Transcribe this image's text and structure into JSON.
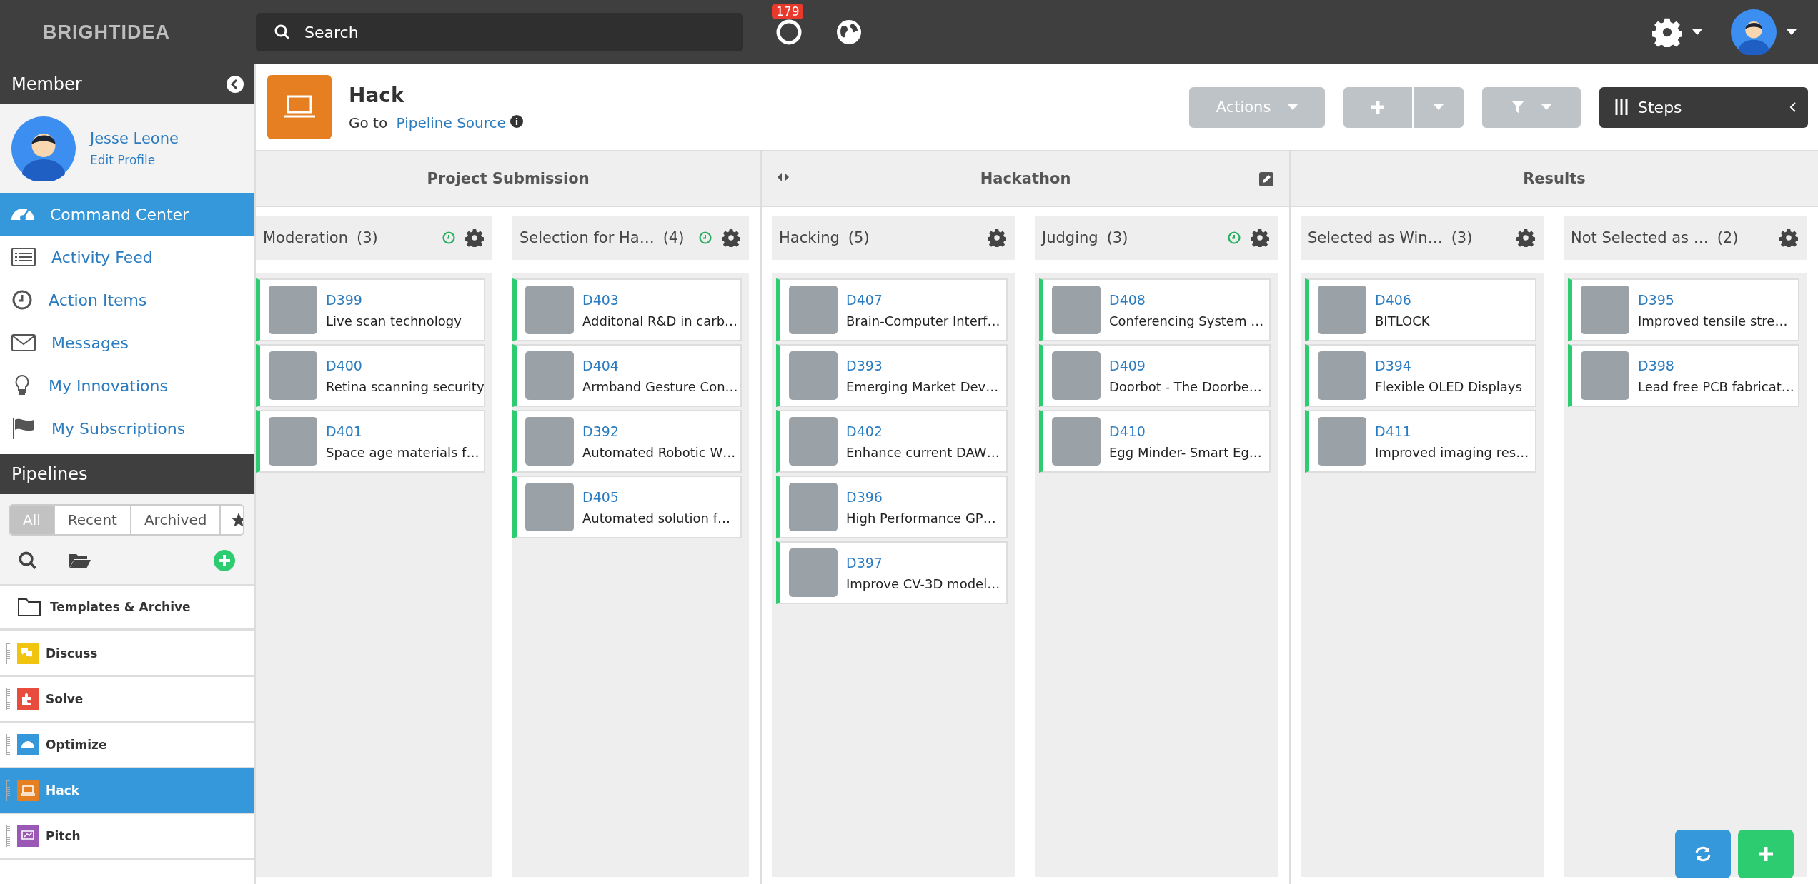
{
  "topbar": {
    "logo": "BRIGHTIDEA",
    "search_placeholder": "Search",
    "notification_count": "179"
  },
  "sidebar": {
    "member_title": "Member",
    "user_name": "Jesse Leone",
    "edit_profile": "Edit Profile",
    "nav": [
      {
        "label": "Command Center",
        "kind": "dashboard",
        "selected": true
      },
      {
        "label": "Activity Feed",
        "kind": "feed",
        "selected": false
      },
      {
        "label": "Action Items",
        "kind": "tasks",
        "selected": false
      },
      {
        "label": "Messages",
        "kind": "messages",
        "selected": false
      },
      {
        "label": "My Innovations",
        "kind": "innovations",
        "selected": false
      },
      {
        "label": "My Subscriptions",
        "kind": "subscriptions",
        "selected": false
      }
    ],
    "pipelines_title": "Pipelines",
    "filter_tabs": [
      {
        "label": "All",
        "selected": true
      },
      {
        "label": "Recent",
        "selected": false
      },
      {
        "label": "Archived",
        "selected": false
      }
    ],
    "templates": "Templates & Archive",
    "pipelines": [
      {
        "label": "Discuss",
        "color": "#f1c40f",
        "kind": "discuss",
        "selected": false
      },
      {
        "label": "Solve",
        "color": "#e74c3c",
        "kind": "solve",
        "selected": false
      },
      {
        "label": "Optimize",
        "color": "#3498db",
        "kind": "optimize",
        "selected": false
      },
      {
        "label": "Hack",
        "color": "#e67e22",
        "kind": "hack",
        "selected": true
      },
      {
        "label": "Pitch",
        "color": "#9b59b6",
        "kind": "pitch",
        "selected": false
      }
    ]
  },
  "header": {
    "title": "Hack",
    "goto_prefix": "Go to",
    "goto_link": "Pipeline Source",
    "actions": "Actions",
    "steps": "Steps"
  },
  "stages": [
    {
      "title": "Project Submission",
      "arrows": false,
      "edit": false,
      "lanes": [
        {
          "title": "Moderation",
          "count": "(3)",
          "timer": true,
          "cards": [
            {
              "id": "D399",
              "text": "Live scan technology"
            },
            {
              "id": "D400",
              "text": "Retina scanning security"
            },
            {
              "id": "D401",
              "text": "Space age materials f…"
            }
          ]
        },
        {
          "title": "Selection for Ha…",
          "count": "(4)",
          "timer": true,
          "cards": [
            {
              "id": "D403",
              "text": "Additonal R&D in carb…"
            },
            {
              "id": "D404",
              "text": "Armband Gesture Con…"
            },
            {
              "id": "D392",
              "text": "Automated Robotic W…"
            },
            {
              "id": "D405",
              "text": "Automated solution f…"
            }
          ]
        }
      ]
    },
    {
      "title": "Hackathon",
      "arrows": true,
      "edit": true,
      "lanes": [
        {
          "title": "Hacking",
          "count": "(5)",
          "timer": false,
          "cards": [
            {
              "id": "D407",
              "text": "Brain-Computer Interf…"
            },
            {
              "id": "D393",
              "text": "Emerging Market Dev…"
            },
            {
              "id": "D402",
              "text": "Enhance current DAW…"
            },
            {
              "id": "D396",
              "text": "High Performance GP…"
            },
            {
              "id": "D397",
              "text": "Improve CV-3D model…"
            }
          ]
        },
        {
          "title": "Judging",
          "count": "(3)",
          "timer": true,
          "cards": [
            {
              "id": "D408",
              "text": "Conferencing System …"
            },
            {
              "id": "D409",
              "text": "Doorbot - The Doorbe…"
            },
            {
              "id": "D410",
              "text": "Egg Minder- Smart Eg…"
            }
          ]
        }
      ]
    },
    {
      "title": "Results",
      "arrows": false,
      "edit": false,
      "lanes": [
        {
          "title": "Selected as Win…",
          "count": "(3)",
          "timer": false,
          "cards": [
            {
              "id": "D406",
              "text": "BITLOCK"
            },
            {
              "id": "D394",
              "text": "Flexible OLED Displays"
            },
            {
              "id": "D411",
              "text": "Improved imaging res…"
            }
          ]
        },
        {
          "title": "Not Selected as …",
          "count": "(2)",
          "timer": false,
          "cards": [
            {
              "id": "D395",
              "text": "Improved tensile stre…"
            },
            {
              "id": "D398",
              "text": "Lead free PCB fabricat…"
            }
          ]
        }
      ]
    }
  ]
}
